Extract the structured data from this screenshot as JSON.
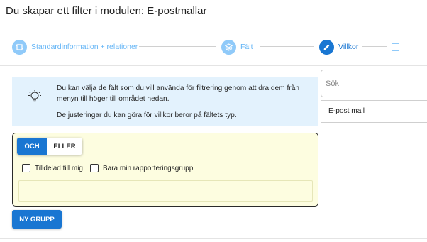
{
  "page": {
    "title": "Du skapar ett filter i modulen: E-postmallar"
  },
  "stepper": {
    "steps": [
      {
        "label": "Standardinformation + relationer",
        "icon": "grid-icon",
        "active": false
      },
      {
        "label": "Fält",
        "icon": "layers-icon",
        "active": false
      },
      {
        "label": "Villkor",
        "icon": "pencil-icon",
        "active": true
      }
    ]
  },
  "info": {
    "icon": "lightbulb-icon",
    "line1": "Du kan välja de fält som du vill använda för filtrering genom att dra dem från menyn till höger till området nedan.",
    "line2": "De justeringar du kan göra för villkor beror på fältets typ."
  },
  "fields_panel": {
    "search_placeholder": "Sök",
    "items": [
      "E-post mall"
    ]
  },
  "condition_group": {
    "operators": [
      "OCH",
      "ELLER"
    ],
    "selected_operator": "OCH",
    "checkboxes": [
      {
        "label": "Tilldelad till mig",
        "checked": false
      },
      {
        "label": "Bara min rapporteringsgrupp",
        "checked": false
      }
    ]
  },
  "actions": {
    "new_group_label": "NY GRUPP"
  },
  "colors": {
    "primary": "#1976d2",
    "step_inactive": "#90caf9",
    "info_bg": "#e3f2fd",
    "group_bg": "#fdfde0"
  }
}
